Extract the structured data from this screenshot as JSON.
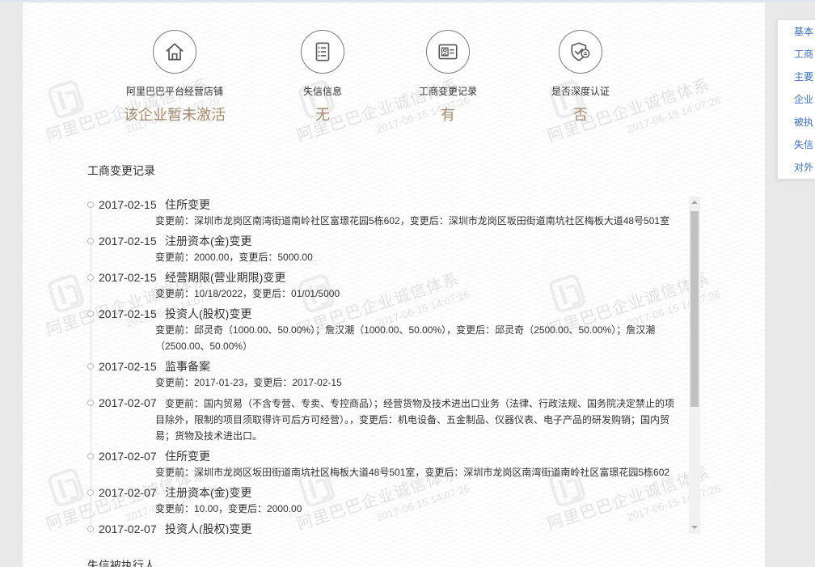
{
  "side_nav": {
    "items": [
      "基本",
      "工商",
      "主要",
      "企业",
      "被执",
      "失信",
      "对外"
    ]
  },
  "summary": {
    "items": [
      {
        "icon": "home-icon",
        "label": "阿里巴巴平台经营店铺",
        "value": "该企业暂未激活"
      },
      {
        "icon": "list-document-icon",
        "label": "失信信息",
        "value": "无"
      },
      {
        "icon": "id-card-icon",
        "label": "工商变更记录",
        "value": "有"
      },
      {
        "icon": "certified-shield-icon",
        "label": "是否深度认证",
        "value": "否"
      }
    ]
  },
  "changes": {
    "title": "工商变更记录",
    "records": [
      {
        "date": "2017-02-15",
        "type": "住所变更",
        "detail": "变更前：深圳市龙岗区南湾街道南岭社区富璟花园5栋602，变更后：深圳市龙岗区坂田街道南坑社区梅板大道48号501室"
      },
      {
        "date": "2017-02-15",
        "type": "注册资本(金)变更",
        "detail": "变更前：2000.00，变更后：5000.00"
      },
      {
        "date": "2017-02-15",
        "type": "经营期限(营业期限)变更",
        "detail": "变更前：10/18/2022，变更后：01/01/5000"
      },
      {
        "date": "2017-02-15",
        "type": "投资人(股权)变更",
        "detail": "变更前：邱灵奇（1000.00、50.00%）；詹汉潮（1000.00、50.00%），变更后：邱灵奇（2500.00、50.00%）；詹汉潮（2500.00、50.00%）"
      },
      {
        "date": "2017-02-15",
        "type": "监事备案",
        "detail": "变更前：2017-01-23，变更后：2017-02-15"
      },
      {
        "date": "2017-02-07",
        "detail": "变更前：国内贸易（不含专营、专卖、专控商品）；经营货物及技术进出口业务（法律、行政法规、国务院决定禁止的项目除外，限制的项目须取得许可后方可经营）。，变更后：机电设备、五金制品、仪器仪表、电子产品的研发购销；国内贸易；货物及技术进出口。"
      },
      {
        "date": "2017-02-07",
        "type": "住所变更",
        "detail": "变更前：深圳市龙岗区坂田街道南坑社区梅板大道48号501室，变更后：深圳市龙岗区南湾街道南岭社区富璟花园5栋602"
      },
      {
        "date": "2017-02-07",
        "type": "注册资本(金)变更",
        "detail": "变更前：10.00，变更后：2000.00"
      },
      {
        "date": "2017-02-07",
        "type": "投资人(股权)变更"
      }
    ]
  },
  "next_section": {
    "title": "失信被执行人"
  },
  "watermark": {
    "text": "阿里巴巴企业诚信体系",
    "timestamp": "2017-06-15 14:07:26"
  },
  "colors": {
    "value_text": "#a68a6c",
    "nav_link": "#3b6fc5",
    "text": "#333333",
    "page_background": "#e9e9e9"
  }
}
